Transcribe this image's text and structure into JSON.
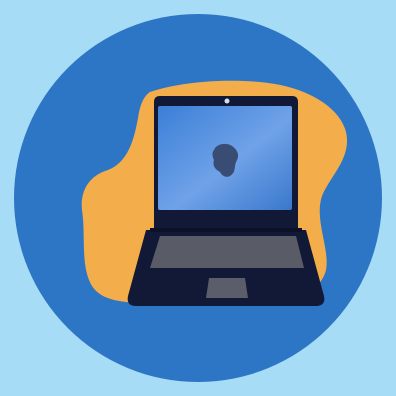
{
  "illustration": {
    "subject": "laptop-icon",
    "colors": {
      "background": "#a7dcf6",
      "circle": "#2d76c6",
      "blob": "#f3ad4a",
      "laptop_body": "#121936",
      "screen": "#4d8ee0",
      "keyboard": "#595b66",
      "trackpad": "#5b5d6a",
      "logo": "#394c73"
    }
  }
}
